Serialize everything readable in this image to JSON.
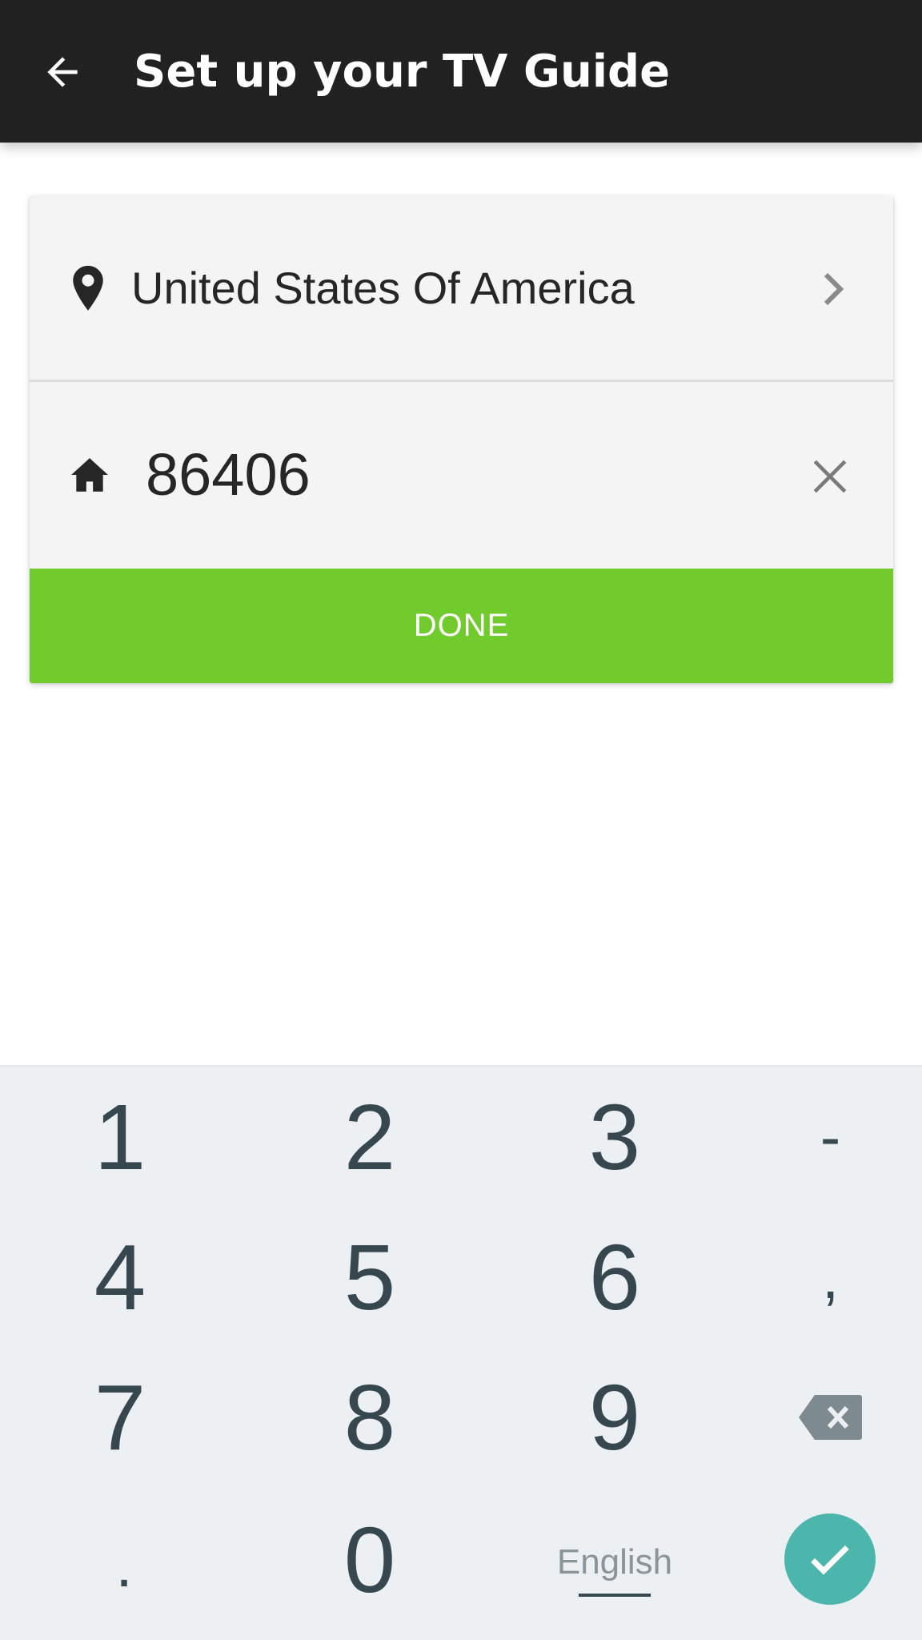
{
  "appbar": {
    "title": "Set up your TV Guide",
    "back_icon": "arrow-back-icon",
    "background": "#212121"
  },
  "location": {
    "country": "United States Of America",
    "icon": "location-pin-icon",
    "trailing_icon": "chevron-right-icon"
  },
  "zip": {
    "value": "86406",
    "icon": "home-icon",
    "clear_icon": "close-icon"
  },
  "done_button": {
    "label": "DONE",
    "color": "#72cb2c"
  },
  "keyboard": {
    "row1": [
      "1",
      "2",
      "3",
      "-"
    ],
    "row2": [
      "4",
      "5",
      "6",
      ","
    ],
    "row3": [
      "7",
      "8",
      "9"
    ],
    "row4_left": ".",
    "row4_zero": "0",
    "language": "English",
    "backspace_icon": "backspace-icon",
    "enter_icon": "checkmark-icon",
    "enter_color": "#4db6ac"
  }
}
